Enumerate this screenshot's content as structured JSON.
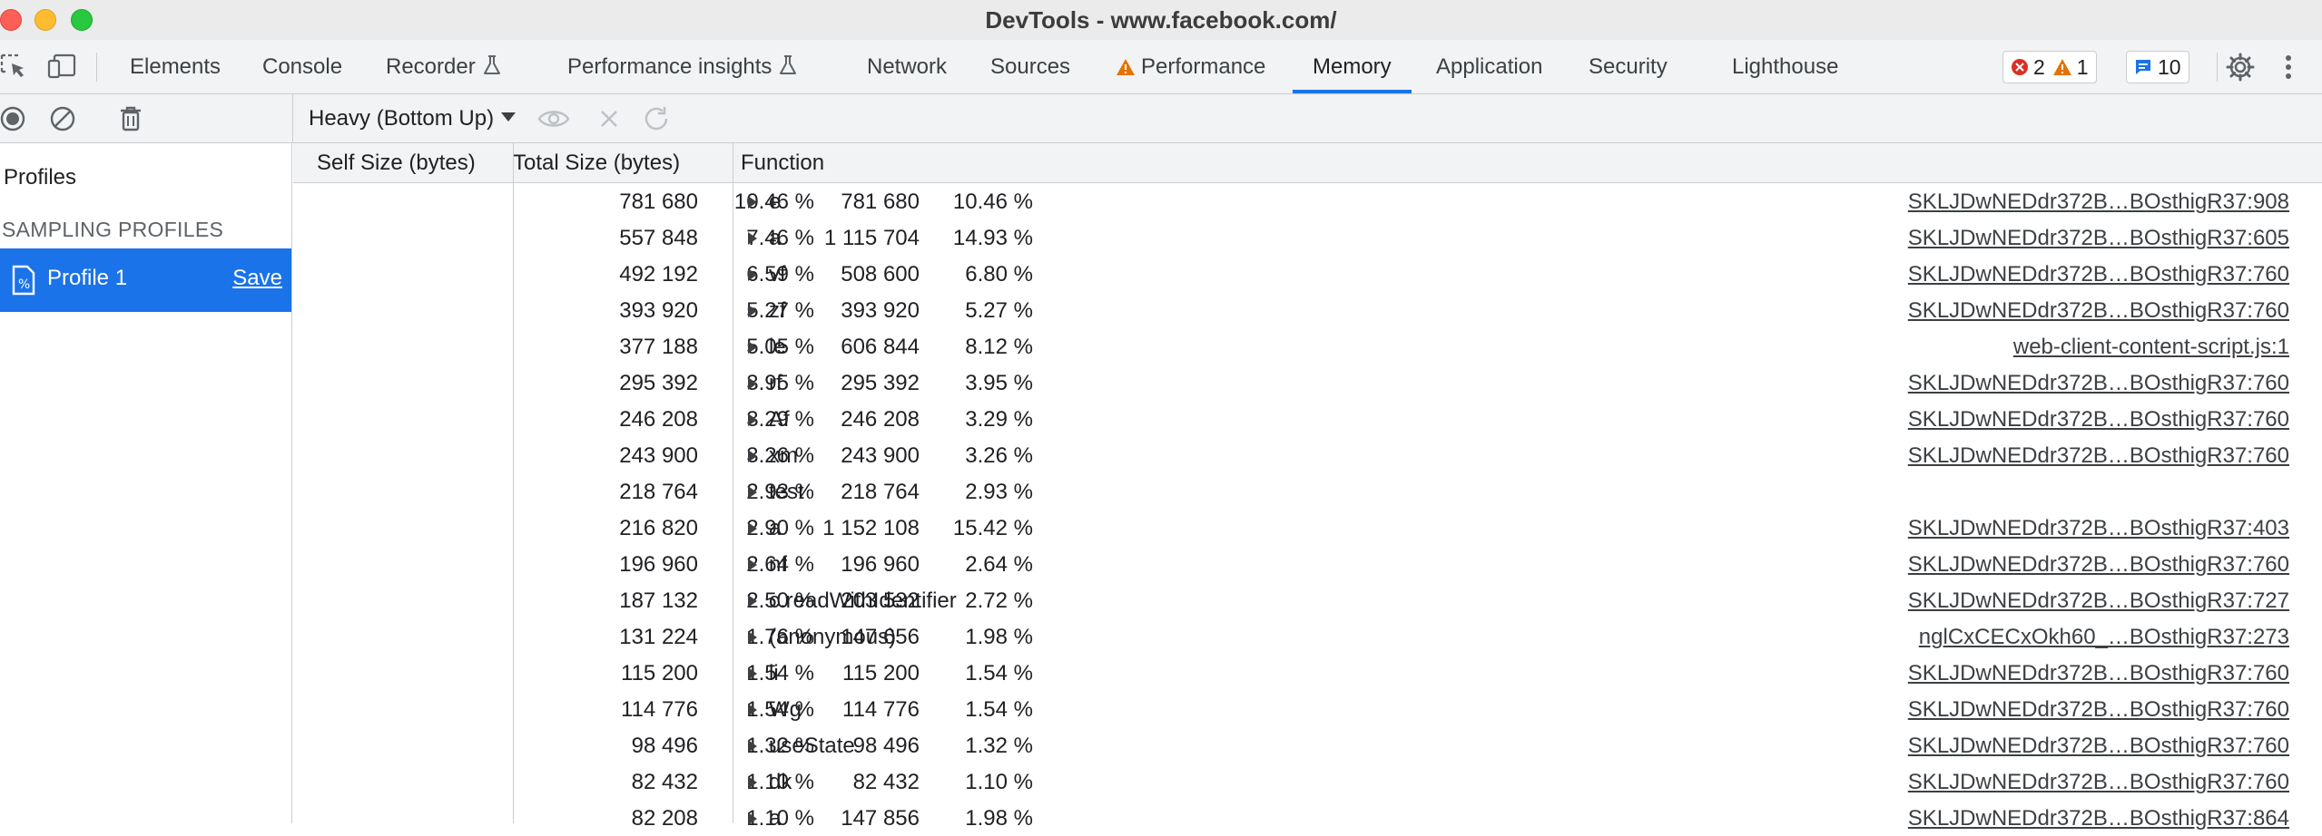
{
  "window": {
    "title": "DevTools - www.facebook.com/"
  },
  "tabs": [
    {
      "label": "Elements",
      "flask": false,
      "warning": false
    },
    {
      "label": "Console",
      "flask": false,
      "warning": false
    },
    {
      "label": "Recorder",
      "flask": true,
      "warning": false
    },
    {
      "label": "Performance insights",
      "flask": true,
      "warning": false
    },
    {
      "label": "Network",
      "flask": false,
      "warning": false
    },
    {
      "label": "Sources",
      "flask": false,
      "warning": false
    },
    {
      "label": "Performance",
      "flask": false,
      "warning": true
    },
    {
      "label": "Memory",
      "flask": false,
      "warning": false,
      "active": true
    },
    {
      "label": "Application",
      "flask": false,
      "warning": false
    },
    {
      "label": "Security",
      "flask": false,
      "warning": false
    },
    {
      "label": "Lighthouse",
      "flask": false,
      "warning": false
    }
  ],
  "counters": {
    "errors": "2",
    "warnings": "1",
    "messages": "10"
  },
  "toolbar": {
    "view_mode": "Heavy (Bottom Up)"
  },
  "sidebar": {
    "heading": "Profiles",
    "section": "SAMPLING PROFILES",
    "profile_name": "Profile 1",
    "save_label": "Save"
  },
  "grid": {
    "headers": {
      "self": "Self Size (bytes)",
      "total": "Total Size (bytes)",
      "function": "Function"
    },
    "rows": [
      {
        "self": "781 680",
        "self_pct": "10.46 %",
        "total": "781 680",
        "total_pct": "10.46 %",
        "fn": "e",
        "url": "SKLJDwNEDdr372B…BOsthigR37:908"
      },
      {
        "self": "557 848",
        "self_pct": "7.46 %",
        "total": "1 115 704",
        "total_pct": "14.93 %",
        "fn": "a",
        "url": "SKLJDwNEDdr372B…BOsthigR37:605"
      },
      {
        "self": "492 192",
        "self_pct": "6.59 %",
        "total": "508 600",
        "total_pct": "6.80 %",
        "fn": "vf",
        "url": "SKLJDwNEDdr372B…BOsthigR37:760"
      },
      {
        "self": "393 920",
        "self_pct": "5.27 %",
        "total": "393 920",
        "total_pct": "5.27 %",
        "fn": "zf",
        "url": "SKLJDwNEDdr372B…BOsthigR37:760"
      },
      {
        "self": "377 188",
        "self_pct": "5.05 %",
        "total": "606 844",
        "total_pct": "8.12 %",
        "fn": "le",
        "url": "web-client-content-script.js:1"
      },
      {
        "self": "295 392",
        "self_pct": "3.95 %",
        "total": "295 392",
        "total_pct": "3.95 %",
        "fn": "rf",
        "url": "SKLJDwNEDdr372B…BOsthigR37:760"
      },
      {
        "self": "246 208",
        "self_pct": "3.29 %",
        "total": "246 208",
        "total_pct": "3.29 %",
        "fn": "Af",
        "url": "SKLJDwNEDdr372B…BOsthigR37:760"
      },
      {
        "self": "243 900",
        "self_pct": "3.26 %",
        "total": "243 900",
        "total_pct": "3.26 %",
        "fn": "xm",
        "url": "SKLJDwNEDdr372B…BOsthigR37:760"
      },
      {
        "self": "218 764",
        "self_pct": "2.93 %",
        "total": "218 764",
        "total_pct": "2.93 %",
        "fn": "test",
        "url": ""
      },
      {
        "self": "216 820",
        "self_pct": "2.90 %",
        "total": "1 152 108",
        "total_pct": "15.42 %",
        "fn": "a",
        "url": "SKLJDwNEDdr372B…BOsthigR37:403"
      },
      {
        "self": "196 960",
        "self_pct": "2.64 %",
        "total": "196 960",
        "total_pct": "2.64 %",
        "fn": "nf",
        "url": "SKLJDwNEDdr372B…BOsthigR37:760"
      },
      {
        "self": "187 132",
        "self_pct": "2.50 %",
        "total": "203 532",
        "total_pct": "2.72 %",
        "fn": "c.readWithIdentifier",
        "url": "SKLJDwNEDdr372B…BOsthigR37:727"
      },
      {
        "self": "131 224",
        "self_pct": "1.76 %",
        "total": "147 656",
        "total_pct": "1.98 %",
        "fn": "(anonymous)",
        "url": "nglCxCECxOkh60_…BOsthigR37:273"
      },
      {
        "self": "115 200",
        "self_pct": "1.54 %",
        "total": "115 200",
        "total_pct": "1.54 %",
        "fn": "li",
        "url": "SKLJDwNEDdr372B…BOsthigR37:760"
      },
      {
        "self": "114 776",
        "self_pct": "1.54 %",
        "total": "114 776",
        "total_pct": "1.54 %",
        "fn": "Wg",
        "url": "SKLJDwNEDdr372B…BOsthigR37:760"
      },
      {
        "self": "98 496",
        "self_pct": "1.32 %",
        "total": "98 496",
        "total_pct": "1.32 %",
        "fn": "useState",
        "url": "SKLJDwNEDdr372B…BOsthigR37:760"
      },
      {
        "self": "82 432",
        "self_pct": "1.10 %",
        "total": "82 432",
        "total_pct": "1.10 %",
        "fn": "dk",
        "url": "SKLJDwNEDdr372B…BOsthigR37:760"
      },
      {
        "self": "82 208",
        "self_pct": "1.10 %",
        "total": "147 856",
        "total_pct": "1.98 %",
        "fn": "a",
        "url": "SKLJDwNEDdr372B…BOsthigR37:864"
      }
    ]
  }
}
